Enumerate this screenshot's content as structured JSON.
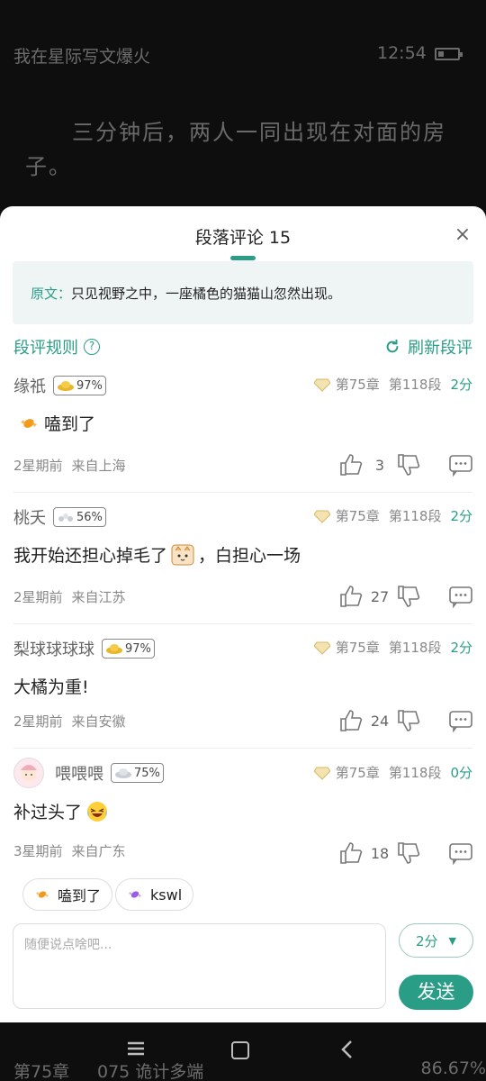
{
  "reader": {
    "book_title": "我在星际写文爆火",
    "clock": "12:54",
    "battery_level": 0.3,
    "paragraph": "三分钟后，两人一同出现在对面的房子。"
  },
  "sheet": {
    "title": "段落评论 15",
    "close_icon": "×",
    "quote_label": "原文：",
    "quote_text": "只见视野之中，一座橘色的猫猫山忽然出现。",
    "rules_label": "段评规则",
    "help_icon": "?",
    "refresh_label": "刷新段评"
  },
  "comments": [
    {
      "username": "缘祇",
      "badge": "97%",
      "badge_icon": "gold-ingot-icon",
      "chapter": "第75章",
      "paragraph": "第118段",
      "score": "2分",
      "text_before": "",
      "text": "嗑到了",
      "text_after": "",
      "time": "2星期前",
      "location": "来自上海",
      "likes": "3"
    },
    {
      "username": "桃夭",
      "badge": "56%",
      "badge_icon": "silver-ingot-icon",
      "chapter": "第75章",
      "paragraph": "第118段",
      "score": "2分",
      "text_before": "我开始还担心掉毛了",
      "text": "",
      "text_after": "，白担心一场",
      "time": "2星期前",
      "location": "来自江苏",
      "likes": "27"
    },
    {
      "username": "梨球球球球",
      "badge": "97%",
      "badge_icon": "gold-ingot-icon",
      "chapter": "第75章",
      "paragraph": "第118段",
      "score": "2分",
      "text_before": "",
      "text": "大橘为重!",
      "text_after": "",
      "time": "2星期前",
      "location": "来自安徽",
      "likes": "24"
    },
    {
      "username": "喂喂喂",
      "badge": "75%",
      "badge_icon": "silver-ingot-icon",
      "chapter": "第75章",
      "paragraph": "第118段",
      "score": "0分",
      "text_before": "",
      "text": "补过头了",
      "text_after": "",
      "time": "3星期前",
      "location": "来自广东",
      "likes": "18"
    }
  ],
  "quick_replies": [
    "嗑到了",
    "kswl"
  ],
  "composer": {
    "placeholder": "随便说点啥吧...",
    "score_value": "2分",
    "caret": "▼",
    "send_label": "发送"
  },
  "footer": {
    "chapter": "第75章",
    "chapter_title": "075 诡计多端",
    "progress": "86.67%"
  },
  "colors": {
    "accent": "#2a9d87",
    "gold": "#e9b52b"
  }
}
